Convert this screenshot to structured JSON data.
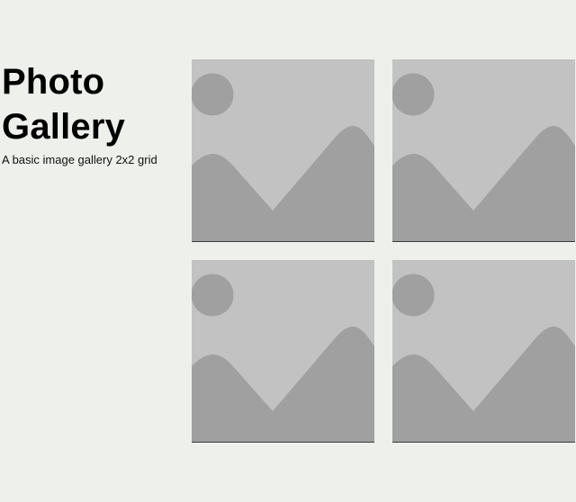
{
  "header": {
    "title": "Photo Gallery",
    "subtitle": "A basic image gallery 2x2 grid"
  },
  "gallery": {
    "items": [
      {
        "icon": "image-placeholder-icon"
      },
      {
        "icon": "image-placeholder-icon"
      },
      {
        "icon": "image-placeholder-icon"
      },
      {
        "icon": "image-placeholder-icon"
      }
    ]
  },
  "colors": {
    "background": "#eef0ec",
    "placeholder_light": "#c2c2c2",
    "placeholder_dark": "#a0a0a0",
    "border": "#3a3a3a",
    "text": "#000000"
  }
}
